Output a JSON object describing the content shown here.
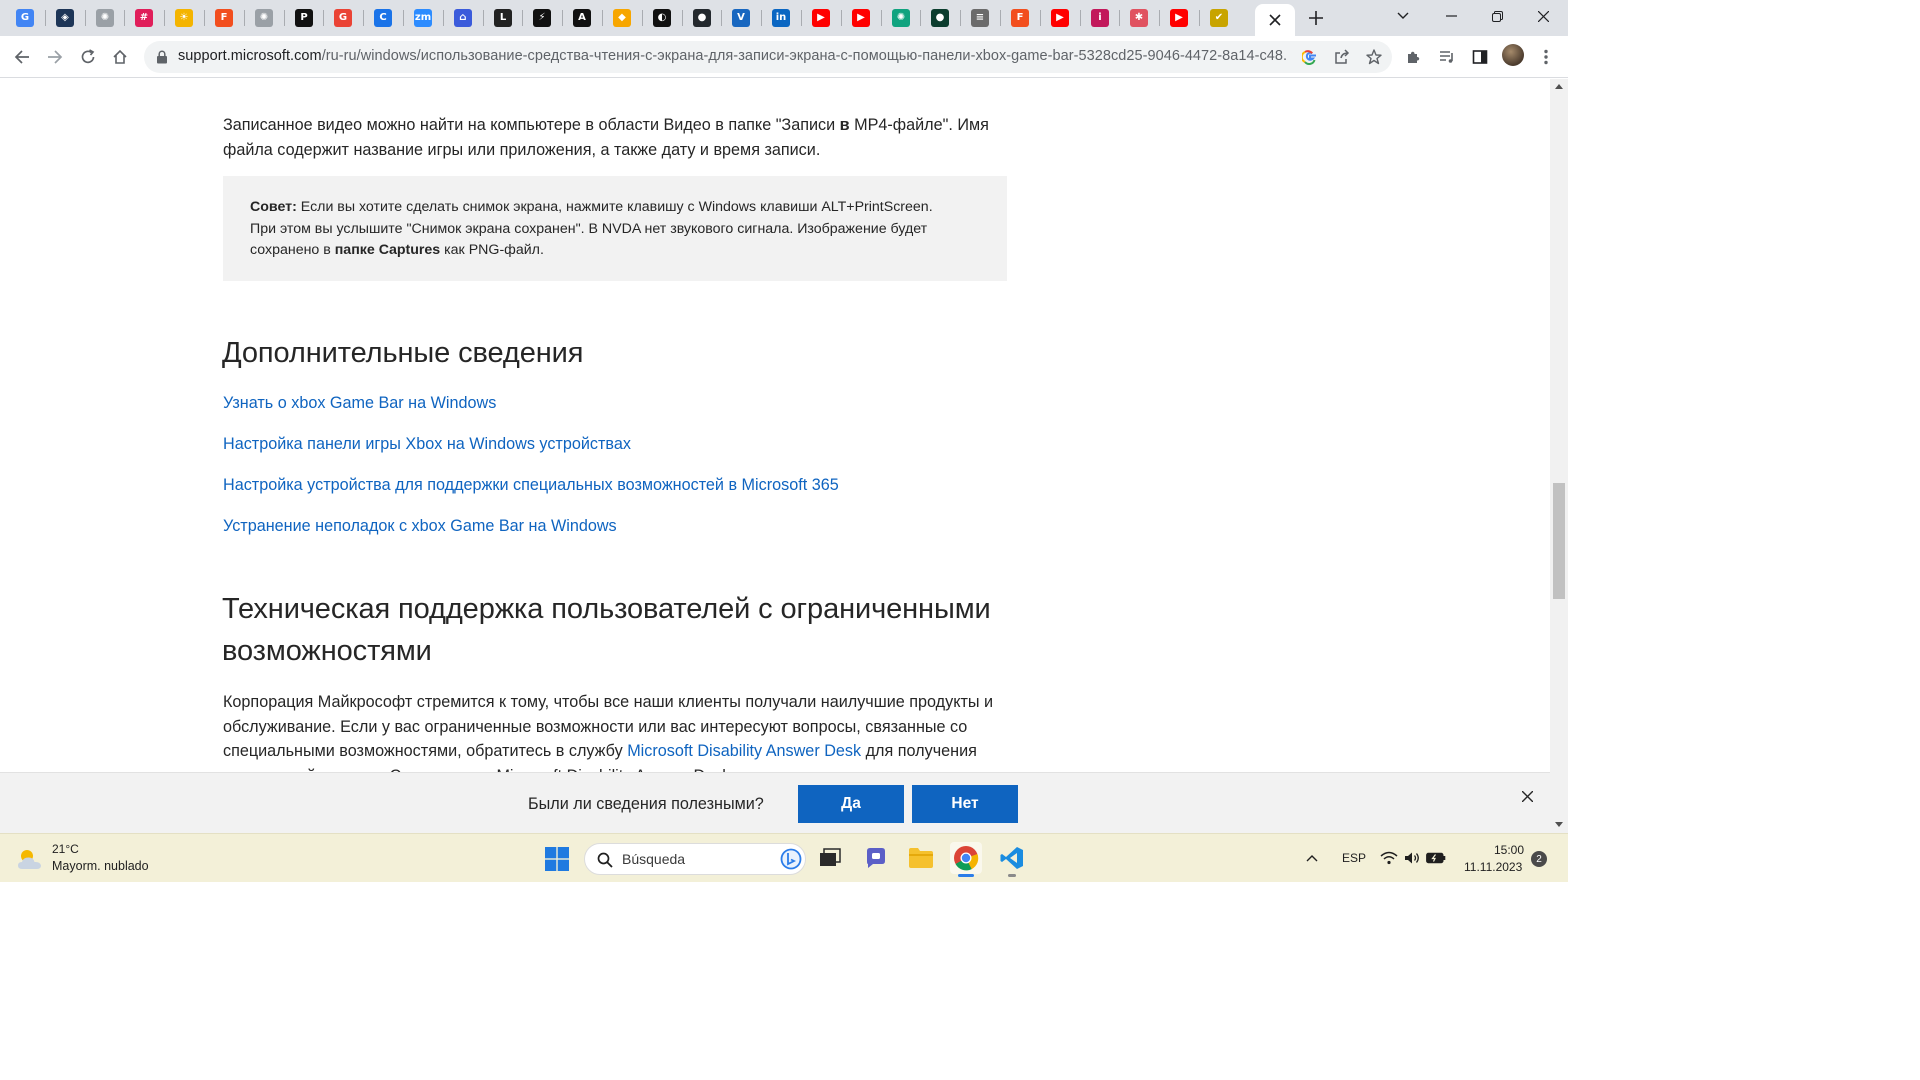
{
  "browser": {
    "favicons": [
      {
        "name": "google-translate-icon",
        "glyph": "G",
        "bg": "#4285f4"
      },
      {
        "name": "perplexity-icon",
        "glyph": "◈",
        "bg": "#1d3557"
      },
      {
        "name": "chatgpt-icon",
        "glyph": "✺",
        "bg": "#9aa0a6"
      },
      {
        "name": "slack-icon",
        "glyph": "#",
        "bg": "#e01e5a"
      },
      {
        "name": "sun-icon",
        "glyph": "☀",
        "bg": "#f4b400"
      },
      {
        "name": "figma-icon",
        "glyph": "F",
        "bg": "#f24e1e"
      },
      {
        "name": "chatgpt-icon-2",
        "glyph": "✺",
        "bg": "#9aa0a6"
      },
      {
        "name": "p-app-icon",
        "glyph": "P",
        "bg": "#111111"
      },
      {
        "name": "google-icon",
        "glyph": "G",
        "bg": "#ea4335"
      },
      {
        "name": "c-app-icon",
        "glyph": "C",
        "bg": "#1a73e8"
      },
      {
        "name": "zoom-icon",
        "glyph": "zm",
        "bg": "#2d8cff"
      },
      {
        "name": "home-app-icon",
        "glyph": "⌂",
        "bg": "#3b5bdb"
      },
      {
        "name": "l-app-icon",
        "glyph": "L",
        "bg": "#222222"
      },
      {
        "name": "bolt-app-icon",
        "glyph": "⚡",
        "bg": "#111111"
      },
      {
        "name": "ai-app-icon",
        "glyph": "A",
        "bg": "#111111"
      },
      {
        "name": "diamond-icon",
        "glyph": "◆",
        "bg": "#f7a600"
      },
      {
        "name": "pacman-icon",
        "glyph": "◐",
        "bg": "#111111"
      },
      {
        "name": "github-icon",
        "glyph": "●",
        "bg": "#24292e"
      },
      {
        "name": "vuetify-icon",
        "glyph": "V",
        "bg": "#1867c0"
      },
      {
        "name": "linkedin-icon",
        "glyph": "in",
        "bg": "#0a66c2"
      },
      {
        "name": "youtube-icon",
        "glyph": "▶",
        "bg": "#ff0000"
      },
      {
        "name": "youtube-icon-2",
        "glyph": "▶",
        "bg": "#ff0000"
      },
      {
        "name": "openai-icon",
        "glyph": "✺",
        "bg": "#10a37f"
      },
      {
        "name": "leaf-app-icon",
        "glyph": "●",
        "bg": "#0b3d2e"
      },
      {
        "name": "doc-app-icon",
        "glyph": "≡",
        "bg": "#6b6b6b"
      },
      {
        "name": "figma-icon-2",
        "glyph": "F",
        "bg": "#f24e1e"
      },
      {
        "name": "youtube-icon-3",
        "glyph": "▶",
        "bg": "#ff0000"
      },
      {
        "name": "person-app-icon",
        "glyph": "i",
        "bg": "#c2185b"
      },
      {
        "name": "octopus-icon",
        "glyph": "✱",
        "bg": "#e05260"
      },
      {
        "name": "youtube-icon-4",
        "glyph": "▶",
        "bg": "#ff0000"
      },
      {
        "name": "check-app-icon",
        "glyph": "✔",
        "bg": "#c8a400"
      }
    ],
    "url_host": "support.microsoft.com",
    "url_path": "/ru-ru/windows/использование-средства-чтения-с-экрана-для-записи-экрана-с-помощью-панели-xbox-game-bar-5328cd25-9046-4472-8a14-c48..."
  },
  "article": {
    "intro_before": "Записанное видео можно найти на компьютере в области Видео в папке \"Записи ",
    "intro_bold": "в",
    "intro_after": " MP4-файле\". Имя файла содержит название игры или приложения, а также дату и время записи.",
    "tip_label": "Совет:",
    "tip_text": " Если вы хотите сделать снимок экрана, нажмите клавишу с Windows клавиши ALT+PrintScreen. При этом вы услышите \"Снимок экрана сохранен\". В NVDA нет звукового сигнала. Изображение будет сохранено в ",
    "tip_bold": "папке Captures",
    "tip_end": " как PNG-файл.",
    "more_heading": "Дополнительные сведения",
    "links": [
      "Узнать о xbox Game Bar на Windows",
      "Настройка панели игры Xbox на Windows устройствах",
      "Настройка устройства для поддержки специальных возможностей в Microsoft 365",
      "Устранение неполадок с xbox Game Bar на Windows"
    ],
    "support_heading": "Техническая поддержка пользователей с ограниченными возможностями",
    "support_text_before": "Корпорация Майкрософт стремится к тому, чтобы все наши клиенты получали наилучшие продукты и обслуживание. Если у вас ограниченные возможности или вас интересуют вопросы, связанные со специальными возможностями, обратитесь в службу ",
    "support_link": "Microsoft Disability Answer Desk",
    "support_text_after": " для получения технической помощи. Специалисты Microsoft Disability Answer Desk"
  },
  "feedback": {
    "question": "Были ли сведения полезными?",
    "yes": "Да",
    "no": "Нет"
  },
  "taskbar": {
    "temperature": "21°C",
    "weather": "Mayorm. nublado",
    "search": "Búsqueda",
    "language": "ESP",
    "time": "15:00",
    "date": "11.11.2023",
    "notifications": "2"
  },
  "colors": {
    "link": "#0f64c0",
    "button": "#0f64c0",
    "taskbar": "#f3f0d8"
  }
}
